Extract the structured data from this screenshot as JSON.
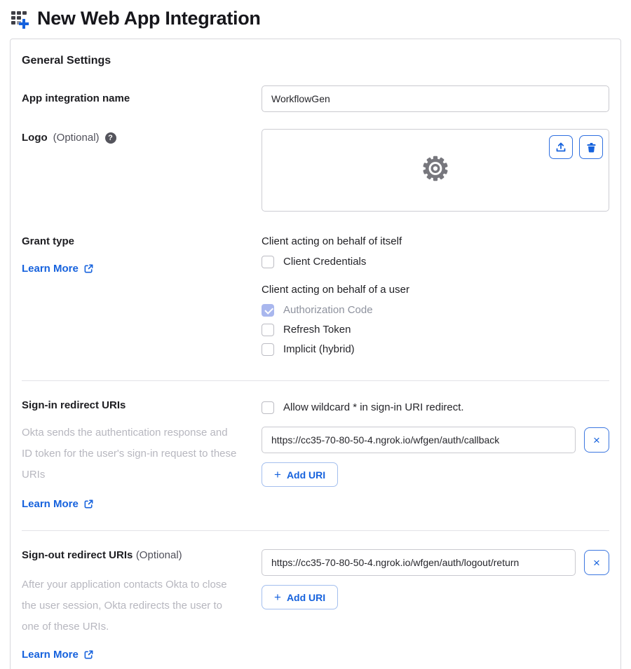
{
  "page": {
    "title": "New Web App Integration"
  },
  "icons": {
    "plus": "+",
    "close": "×",
    "help": "?"
  },
  "colors": {
    "accent_blue": "#1662dd",
    "checked_disabled_fill": "#a9b7ee",
    "card_border": "#d7d7dc",
    "muted_text": "#b7b7bf",
    "gear_gray": "#77777d"
  },
  "card": {
    "heading": "General Settings",
    "app_name": {
      "label": "App integration name",
      "value": "WorkflowGen"
    },
    "logo": {
      "label": "Logo",
      "optional": "(Optional)"
    },
    "grant_type": {
      "label": "Grant type",
      "learn_more": "Learn More",
      "group1": {
        "heading": "Client acting on behalf of itself",
        "options": [
          {
            "label": "Client Credentials",
            "checked": false,
            "disabled": false
          }
        ]
      },
      "group2": {
        "heading": "Client acting on behalf of a user",
        "options": [
          {
            "label": "Authorization Code",
            "checked": true,
            "disabled": true
          },
          {
            "label": "Refresh Token",
            "checked": false,
            "disabled": false
          },
          {
            "label": "Implicit (hybrid)",
            "checked": false,
            "disabled": false
          }
        ]
      }
    },
    "signin": {
      "label": "Sign-in redirect URIs",
      "description": "Okta sends the authentication response and ID token for the user's sign-in request to these URIs",
      "learn_more": "Learn More",
      "wildcard": {
        "label": "Allow wildcard * in sign-in URI redirect.",
        "checked": false
      },
      "uri": "https://cc35-70-80-50-4.ngrok.io/wfgen/auth/callback",
      "add_uri_label": "Add URI"
    },
    "signout": {
      "label": "Sign-out redirect URIs",
      "optional": "(Optional)",
      "description": "After your application contacts Okta to close the user session, Okta redirects the user to one of these URIs.",
      "learn_more": "Learn More",
      "uri": "https://cc35-70-80-50-4.ngrok.io/wfgen/auth/logout/return",
      "add_uri_label": "Add URI"
    }
  }
}
